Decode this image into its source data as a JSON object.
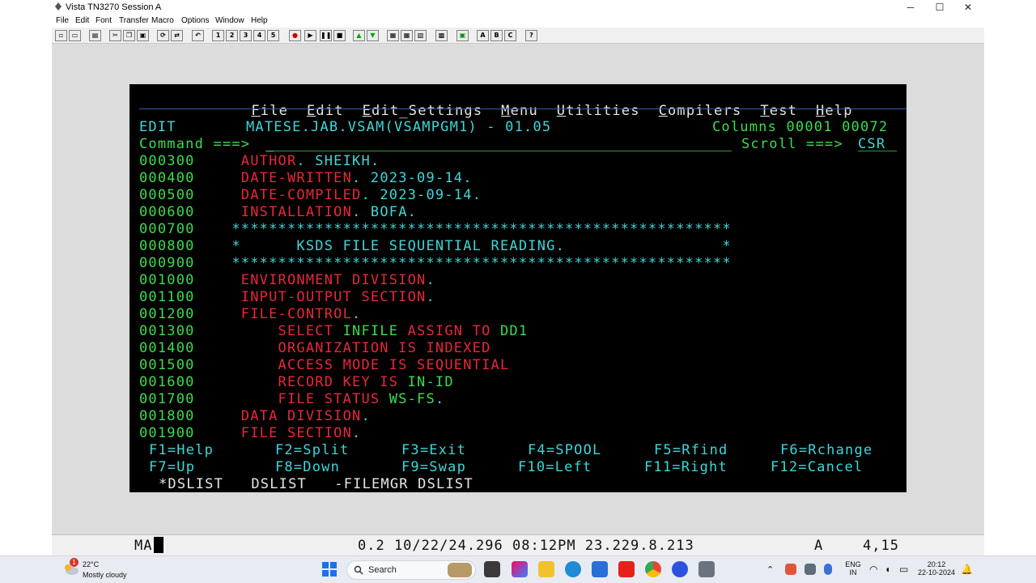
{
  "window": {
    "title": "Vista TN3270 Session A",
    "controls": {
      "minimize": "─",
      "maximize": "☐",
      "close": "✕"
    }
  },
  "menubar": [
    "File",
    "Edit",
    "Font",
    "Transfer",
    "Macro",
    "Options",
    "Window",
    "Help"
  ],
  "toolbar": {
    "buttons": [
      "new-icon",
      "open-icon",
      "print-icon",
      "cut-icon",
      "copy-icon",
      "paste-icon",
      "connect-icon",
      "disconnect-icon",
      "undo-icon",
      "macro-1",
      "macro-2",
      "macro-3",
      "macro-4",
      "macro-5",
      "record-icon",
      "play-icon",
      "pause-icon",
      "stop-icon",
      "up-arrow-icon",
      "down-arrow-icon",
      "settings-icon-1",
      "settings-icon-2",
      "settings-icon-3",
      "settings-icon-4",
      "settings-icon-5",
      "a-button",
      "b-button",
      "c-button",
      "help-icon"
    ],
    "macro_labels": [
      "1",
      "2",
      "3",
      "4",
      "5"
    ],
    "letter_labels": [
      "A",
      "B",
      "C"
    ],
    "help_label": "?"
  },
  "ispf": {
    "menu": [
      {
        "hot": "F",
        "rest": "ile"
      },
      {
        "hot": "E",
        "rest": "dit"
      },
      {
        "hot": "E",
        "rest": "dit_Settings"
      },
      {
        "hot": "M",
        "rest": "enu"
      },
      {
        "hot": "U",
        "rest": "tilities"
      },
      {
        "hot": "C",
        "rest": "ompilers"
      },
      {
        "hot": "T",
        "rest": "est"
      },
      {
        "hot": "H",
        "rest": "elp"
      }
    ],
    "mode": "EDIT",
    "dataset": "MATESE.JAB.VSAM(VSAMPGM1) - 01.05",
    "columns_label": "Columns",
    "columns_from": "00001",
    "columns_to": "00072",
    "command_label": "Command ===>",
    "command_value": "_",
    "scroll_label": "Scroll ===>",
    "scroll_value": "CSR",
    "lines": [
      {
        "num": "000300",
        "parts": [
          {
            "t": "    AUTHOR",
            "c": "red"
          },
          {
            "t": ". SHEIKH.",
            "c": "cyan"
          }
        ]
      },
      {
        "num": "000400",
        "parts": [
          {
            "t": "    DATE-WRITTEN",
            "c": "red"
          },
          {
            "t": ". 2023-09-14.",
            "c": "cyan"
          }
        ]
      },
      {
        "num": "000500",
        "parts": [
          {
            "t": "    DATE-COMPILED",
            "c": "red"
          },
          {
            "t": ". 2023-09-14.",
            "c": "cyan"
          }
        ]
      },
      {
        "num": "000600",
        "parts": [
          {
            "t": "    INSTALLATION",
            "c": "red"
          },
          {
            "t": ". BOFA.",
            "c": "cyan"
          }
        ]
      },
      {
        "num": "000700",
        "parts": [
          {
            "t": "   ******************************************************",
            "c": "cyan"
          }
        ]
      },
      {
        "num": "000800",
        "parts": [
          {
            "t": "   *      KSDS FILE SEQUENTIAL READING.                 *",
            "c": "cyan"
          }
        ]
      },
      {
        "num": "000900",
        "parts": [
          {
            "t": "   ******************************************************",
            "c": "cyan"
          }
        ]
      },
      {
        "num": "001000",
        "parts": [
          {
            "t": "    ENVIRONMENT DIVISION",
            "c": "red"
          },
          {
            "t": ".",
            "c": "cyan"
          }
        ]
      },
      {
        "num": "001100",
        "parts": [
          {
            "t": "    INPUT-OUTPUT SECTION",
            "c": "red"
          },
          {
            "t": ".",
            "c": "cyan"
          }
        ]
      },
      {
        "num": "001200",
        "parts": [
          {
            "t": "    FILE-CONTROL",
            "c": "red"
          },
          {
            "t": ".",
            "c": "cyan"
          }
        ]
      },
      {
        "num": "001300",
        "parts": [
          {
            "t": "        SELECT ",
            "c": "red"
          },
          {
            "t": "INFILE ",
            "c": "green"
          },
          {
            "t": "ASSIGN TO ",
            "c": "red"
          },
          {
            "t": "DD1",
            "c": "green"
          }
        ]
      },
      {
        "num": "001400",
        "parts": [
          {
            "t": "        ORGANIZATION IS INDEXED",
            "c": "red"
          }
        ]
      },
      {
        "num": "001500",
        "parts": [
          {
            "t": "        ACCESS MODE IS SEQUENTIAL",
            "c": "red"
          }
        ]
      },
      {
        "num": "001600",
        "parts": [
          {
            "t": "        RECORD KEY IS ",
            "c": "red"
          },
          {
            "t": "IN-ID",
            "c": "green"
          }
        ]
      },
      {
        "num": "001700",
        "parts": [
          {
            "t": "        FILE STATUS ",
            "c": "red"
          },
          {
            "t": "WS-FS",
            "c": "green"
          },
          {
            "t": ".",
            "c": "cyan"
          }
        ]
      },
      {
        "num": "001800",
        "parts": [
          {
            "t": "    DATA DIVISION",
            "c": "red"
          },
          {
            "t": ".",
            "c": "cyan"
          }
        ]
      },
      {
        "num": "001900",
        "parts": [
          {
            "t": "    FILE SECTION",
            "c": "red"
          },
          {
            "t": ".",
            "c": "cyan"
          }
        ]
      }
    ],
    "fkeys_row1": [
      "F1=Help",
      "F2=Split",
      "F3=Exit",
      "F4=SPOOL",
      "F5=Rfind",
      "F6=Rchange"
    ],
    "fkeys_row2": [
      "F7=Up",
      "F8=Down",
      "F9=Swap",
      "F10=Left",
      "F11=Right",
      "F12=Cancel"
    ],
    "tabs": "*DSLIST   DSLIST   -FILEMGR DSLIST"
  },
  "status": {
    "indicator": "MA",
    "info": "0.2 10/22/24.296 08:12PM 23.229.8.213",
    "mode": "A",
    "cursor_pos": "4,15"
  },
  "taskbar": {
    "weather_badge": "1",
    "temp": "22°C",
    "condition": "Mostly cloudy",
    "search_label": "Search",
    "lang_top": "ENG",
    "lang_bottom": "IN",
    "time": "20:12",
    "date": "22-10-2024"
  },
  "colors": {
    "cyan": "#3fd7d7",
    "green": "#3ddc4f",
    "red": "#e8283a",
    "terminal_bg": "#000000",
    "client_bg": "#dcdcdc"
  }
}
